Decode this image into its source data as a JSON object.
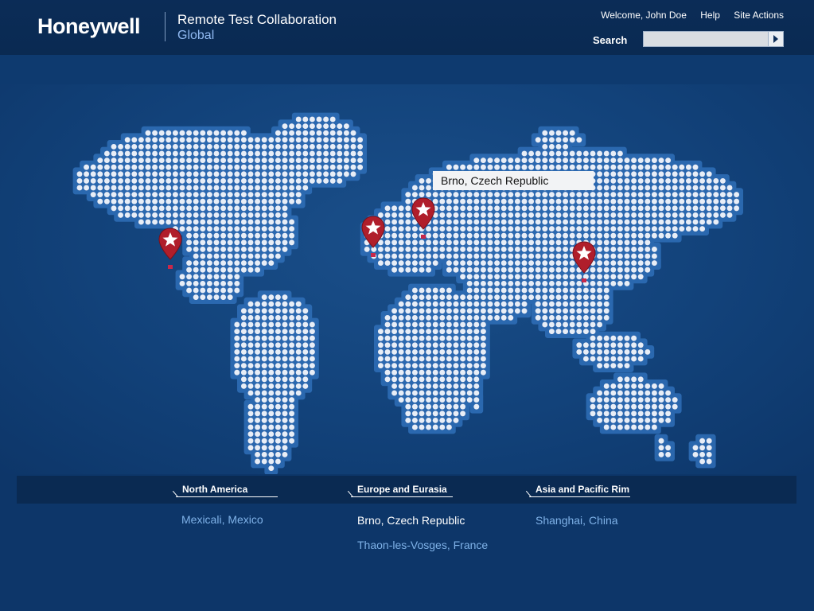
{
  "brand": {
    "logo_text": "Honeywell",
    "app_title": "Remote Test Collaboration",
    "app_subtitle": "Global"
  },
  "top_links": {
    "welcome": "Welcome, John Doe",
    "help": "Help",
    "site_actions": "Site Actions"
  },
  "search": {
    "label": "Search",
    "placeholder": "",
    "button_icon": "play-arrow-icon"
  },
  "map": {
    "tooltip": "Brno, Czech Republic",
    "pins": [
      {
        "name": "Mexicali, Mexico",
        "icon": "map-pin-star-icon"
      },
      {
        "name": "Thaon-les-Vosges, France",
        "icon": "map-pin-star-icon"
      },
      {
        "name": "Brno, Czech Republic",
        "icon": "map-pin-star-icon"
      },
      {
        "name": "Shanghai, China",
        "icon": "map-pin-star-icon"
      }
    ]
  },
  "regions": {
    "north_america": {
      "label": "North America",
      "locations": [
        "Mexicali, Mexico"
      ]
    },
    "europe": {
      "label": "Europe and Eurasia",
      "locations": [
        "Brno, Czech Republic",
        "Thaon-les-Vosges, France"
      ]
    },
    "asia": {
      "label": "Asia and Pacific Rim",
      "locations": [
        "Shanghai, China"
      ]
    }
  },
  "colors": {
    "header": "#0b2c57",
    "background": "#0d3669",
    "pin": "#b01e2b",
    "link": "#7fb2e8",
    "dot": "#e8eef7"
  }
}
